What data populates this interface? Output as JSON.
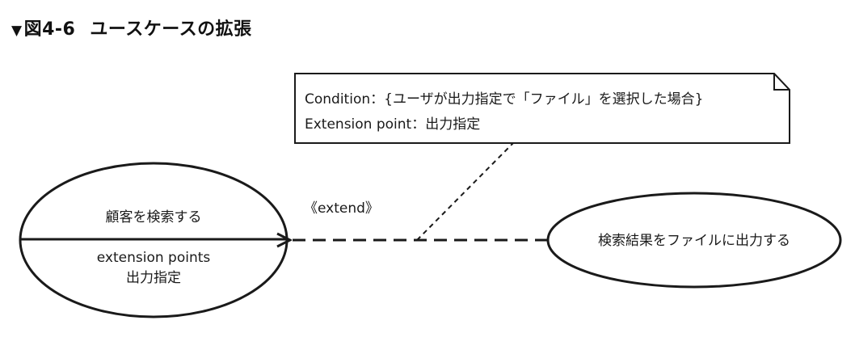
{
  "figure": {
    "marker": "▼",
    "number": "図4-6",
    "title": "ユースケースの拡張"
  },
  "base_use_case": {
    "name": "顧客を検索する",
    "extension_points_heading": "extension points",
    "extension_point": "出力指定"
  },
  "extending_use_case": {
    "name": "検索結果をファイルに出力する"
  },
  "relationship": {
    "stereotype": "《extend》"
  },
  "note": {
    "condition": "Condition：{ユーザが出力指定で「ファイル」を選択した場合}",
    "extension_point": "Extension point：出力指定"
  },
  "colors": {
    "ink": "#1a1a1a",
    "background": "#ffffff"
  }
}
